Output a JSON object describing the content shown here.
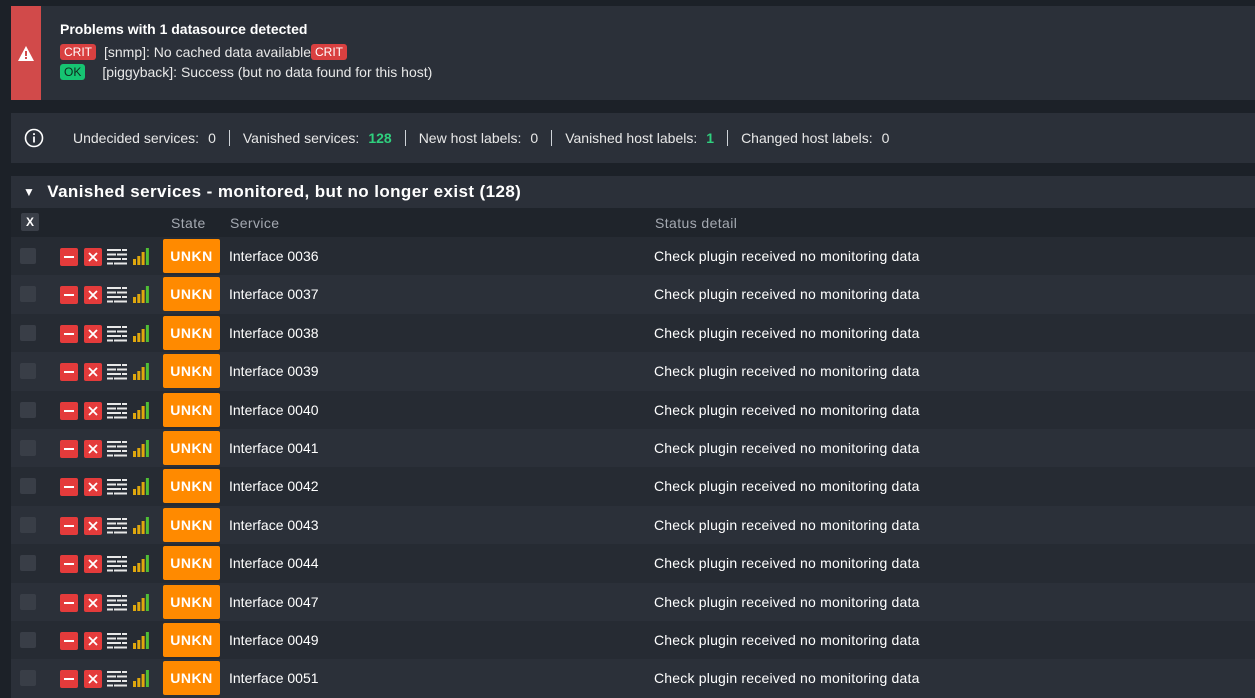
{
  "alert": {
    "title": "Problems with 1 datasource detected",
    "lines": [
      {
        "badge": "CRIT",
        "text": "[snmp]: No cached data available",
        "trailing_badge": "CRIT"
      },
      {
        "badge": "OK",
        "text": "[piggyback]: Success (but no data found for this host)"
      }
    ],
    "icon": "warning-icon"
  },
  "summary": {
    "items": [
      {
        "label": "Undecided services:",
        "value": "0"
      },
      {
        "label": "Vanished services:",
        "value": "128"
      },
      {
        "label": "New host labels:",
        "value": "0"
      },
      {
        "label": "Vanished host labels:",
        "value": "1"
      },
      {
        "label": "Changed host labels:",
        "value": "0"
      }
    ],
    "icon": "info-icon"
  },
  "section": {
    "title": "Vanished services - monitored, but no longer exist (128)"
  },
  "table": {
    "headers": {
      "select": "X",
      "state": "State",
      "service": "Service",
      "detail": "Status detail"
    },
    "rows": [
      {
        "state": "UNKN",
        "service": "Interface 0036",
        "detail": "Check plugin received no monitoring data"
      },
      {
        "state": "UNKN",
        "service": "Interface 0037",
        "detail": "Check plugin received no monitoring data"
      },
      {
        "state": "UNKN",
        "service": "Interface 0038",
        "detail": "Check plugin received no monitoring data"
      },
      {
        "state": "UNKN",
        "service": "Interface 0039",
        "detail": "Check plugin received no monitoring data"
      },
      {
        "state": "UNKN",
        "service": "Interface 0040",
        "detail": "Check plugin received no monitoring data"
      },
      {
        "state": "UNKN",
        "service": "Interface 0041",
        "detail": "Check plugin received no monitoring data"
      },
      {
        "state": "UNKN",
        "service": "Interface 0042",
        "detail": "Check plugin received no monitoring data"
      },
      {
        "state": "UNKN",
        "service": "Interface 0043",
        "detail": "Check plugin received no monitoring data"
      },
      {
        "state": "UNKN",
        "service": "Interface 0044",
        "detail": "Check plugin received no monitoring data"
      },
      {
        "state": "UNKN",
        "service": "Interface 0047",
        "detail": "Check plugin received no monitoring data"
      },
      {
        "state": "UNKN",
        "service": "Interface 0049",
        "detail": "Check plugin received no monitoring data"
      },
      {
        "state": "UNKN",
        "service": "Interface 0051",
        "detail": "Check plugin received no monitoring data"
      }
    ]
  },
  "colors": {
    "crit": "#d94040",
    "ok": "#16c472",
    "unknown": "#ff8a00",
    "highlight_value": "#2fd07e",
    "action_red": "#e43b3b"
  }
}
